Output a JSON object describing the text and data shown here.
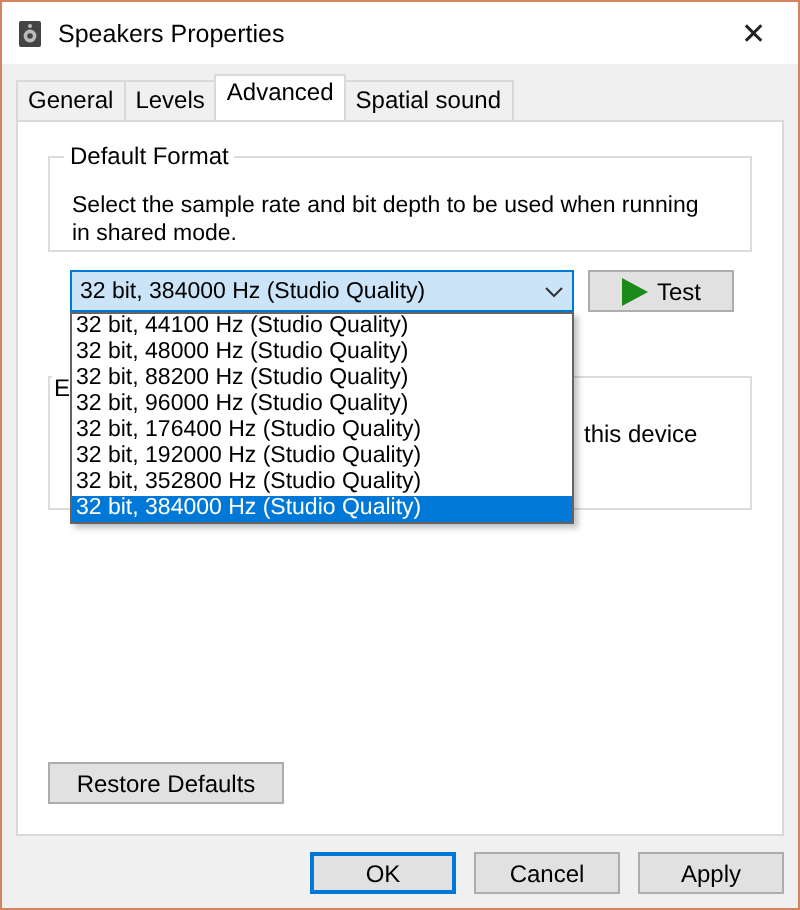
{
  "window": {
    "title": "Speakers Properties",
    "close": "✕"
  },
  "tabs": [
    {
      "label": "General",
      "selected": false
    },
    {
      "label": "Levels",
      "selected": false
    },
    {
      "label": "Advanced",
      "selected": true
    },
    {
      "label": "Spatial sound",
      "selected": false
    }
  ],
  "default_format": {
    "title": "Default Format",
    "description": "Select the sample rate and bit depth to be used when running in shared mode.",
    "value": "32 bit, 384000 Hz (Studio Quality)",
    "expanded": true,
    "options": [
      {
        "label": "32 bit, 44100 Hz (Studio Quality)",
        "selected": false
      },
      {
        "label": "32 bit, 48000 Hz (Studio Quality)",
        "selected": false
      },
      {
        "label": "32 bit, 88200 Hz (Studio Quality)",
        "selected": false
      },
      {
        "label": "32 bit, 96000 Hz (Studio Quality)",
        "selected": false
      },
      {
        "label": "32 bit, 176400 Hz (Studio Quality)",
        "selected": false
      },
      {
        "label": "32 bit, 192000 Hz (Studio Quality)",
        "selected": false
      },
      {
        "label": "32 bit, 352800 Hz (Studio Quality)",
        "selected": false
      },
      {
        "label": "32 bit, 384000 Hz (Studio Quality)",
        "selected": true
      }
    ],
    "test_button": "Test"
  },
  "exclusive_group": {
    "title": "E",
    "text": "this device"
  },
  "restore_button": "Restore Defaults",
  "buttons": [
    {
      "label": "OK",
      "default": true
    },
    {
      "label": "Cancel",
      "default": false
    },
    {
      "label": "Apply",
      "default": false
    }
  ]
}
